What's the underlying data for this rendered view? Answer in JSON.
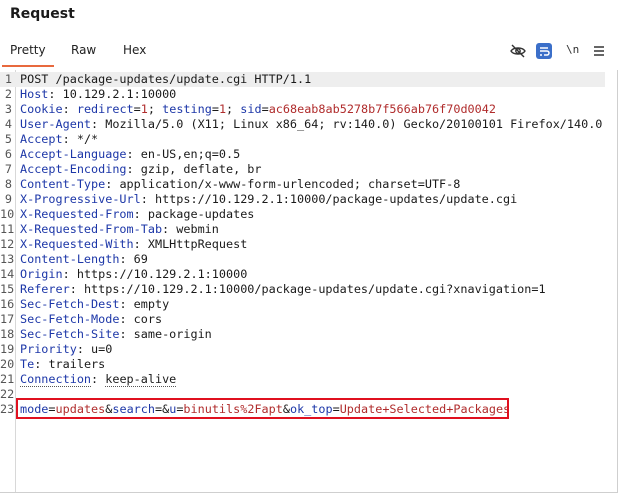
{
  "panel": {
    "title": "Request"
  },
  "tabs": [
    {
      "label": "Pretty",
      "active": true
    },
    {
      "label": "Raw",
      "active": false
    },
    {
      "label": "Hex",
      "active": false
    }
  ],
  "toolbar": {
    "newline_label": "\\n",
    "icons": [
      "eye-off-icon",
      "wrap-text-icon",
      "newline-icon",
      "menu-icon"
    ]
  },
  "request": {
    "request_line": "POST /package-updates/update.cgi HTTP/1.1",
    "headers": [
      {
        "key": "Host",
        "value": "10.129.2.1:10000"
      },
      {
        "key": "Cookie",
        "cookie": [
          {
            "name": "redirect",
            "value": "1"
          },
          {
            "name": "testing",
            "value": "1"
          },
          {
            "name": "sid",
            "value": "ac68eab8ab5278b7f566ab76f70d0042"
          }
        ]
      },
      {
        "key": "User-Agent",
        "value": "Mozilla/5.0 (X11; Linux x86_64; rv:140.0) Gecko/20100101 Firefox/140.0"
      },
      {
        "key": "Accept",
        "value": "*/*"
      },
      {
        "key": "Accept-Language",
        "value": "en-US,en;q=0.5"
      },
      {
        "key": "Accept-Encoding",
        "value": "gzip, deflate, br"
      },
      {
        "key": "Content-Type",
        "value": "application/x-www-form-urlencoded; charset=UTF-8"
      },
      {
        "key": "X-Progressive-Url",
        "value": "https://10.129.2.1:10000/package-updates/update.cgi"
      },
      {
        "key": "X-Requested-From",
        "value": "package-updates"
      },
      {
        "key": "X-Requested-From-Tab",
        "value": "webmin"
      },
      {
        "key": "X-Requested-With",
        "value": "XMLHttpRequest"
      },
      {
        "key": "Content-Length",
        "value": "69"
      },
      {
        "key": "Origin",
        "value": "https://10.129.2.1:10000"
      },
      {
        "key": "Referer",
        "value": "https://10.129.2.1:10000/package-updates/update.cgi?xnavigation=1"
      },
      {
        "key": "Sec-Fetch-Dest",
        "value": "empty"
      },
      {
        "key": "Sec-Fetch-Mode",
        "value": "cors"
      },
      {
        "key": "Sec-Fetch-Site",
        "value": "same-origin"
      },
      {
        "key": "Priority",
        "value": "u=0"
      },
      {
        "key": "Te",
        "value": "trailers"
      },
      {
        "key": "Connection",
        "value": "keep-alive"
      }
    ],
    "body_params": [
      {
        "name": "mode",
        "value": "updates"
      },
      {
        "name": "search",
        "value": ""
      },
      {
        "name": "u",
        "value": "binutils%2Fapt"
      },
      {
        "name": "ok_top",
        "value": "Update+Selected+Packages"
      }
    ]
  },
  "colors": {
    "accent": "#e8693e",
    "highlight_border": "#e0101f",
    "header_key": "#1d37a8",
    "cookie_value": "#b02c2c"
  }
}
